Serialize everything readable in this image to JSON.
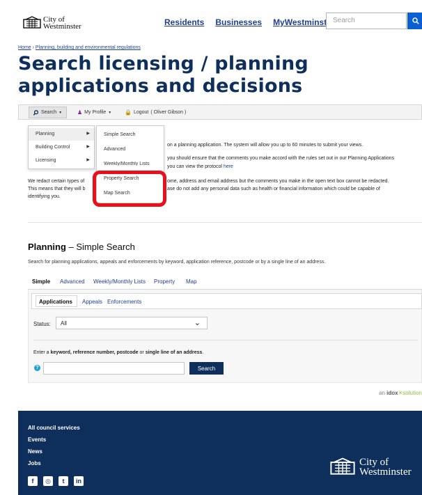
{
  "header": {
    "logo_line1": "City of",
    "logo_line2": "Westminster",
    "nav": [
      "Residents",
      "Businesses",
      "MyWestminster account"
    ],
    "search_placeholder": "Search"
  },
  "breadcrumb": {
    "home": "Home",
    "sep": " › ",
    "section": "Planning, building and environmental regulations"
  },
  "page_title": "Search licensing / planning applications and decisions",
  "toolbar": {
    "search": "Search",
    "profile": "My Profile",
    "logout": "Logout",
    "user": "( Oliver Gibson )"
  },
  "dropdown_menu": {
    "items": [
      "Planning",
      "Building Control",
      "Licensing"
    ]
  },
  "submenu": {
    "items": [
      "Simple Search",
      "Advanced",
      "Weekly/Monthly Lists",
      "Property Search",
      "Map Search"
    ]
  },
  "intro": {
    "line1": "on a planning application. The system will allow you up to 60 minutes to submit your views.",
    "line2": "you should ensure that the comments you make accord with the rules set out in our Planning Applications",
    "line3": "you can view the protocol ",
    "line3_link": "here",
    "line4a": "We redact certain types of",
    "line4b": "ome, address and email address but the comments you make in the open text box cannot be redacted.",
    "line5a": "This means that they will b",
    "line5b": "ase do not add any personal data such as health or financial information which could be capable of",
    "line6": "identifying you."
  },
  "section": {
    "title_bold": "Planning",
    "title_rest": " – Simple Search",
    "subtitle": "Search for planning applications, appeals and enforcements by keyword, application reference, postcode or by a single line of an address."
  },
  "tabs": [
    "Simple",
    "Advanced",
    "Weekly/Monthly Lists",
    "Property",
    "Map"
  ],
  "subtabs": [
    "Applications",
    "Appeals",
    "Enforcements"
  ],
  "status": {
    "label": "Status:",
    "value": "All"
  },
  "search_form": {
    "prompt_a": "Enter a ",
    "prompt_keyword": "keyword, reference number, postcode",
    "prompt_or": " or ",
    "prompt_address": "single line of an address",
    "prompt_end": ".",
    "help": "?",
    "button": "Search"
  },
  "idox": {
    "an": "an ",
    "brand": "idox",
    "solution": "solution"
  },
  "footer": {
    "links": [
      "All council services",
      "Events",
      "News",
      "Jobs"
    ],
    "social": [
      "f",
      "◎",
      "t",
      "in"
    ],
    "logo_line1": "City of",
    "logo_line2": "Westminster"
  },
  "colors": {
    "navy": "#0e2e5c",
    "link": "#1f3f8f",
    "search_blue": "#0a5fd4",
    "highlight_red": "#e8101c"
  }
}
